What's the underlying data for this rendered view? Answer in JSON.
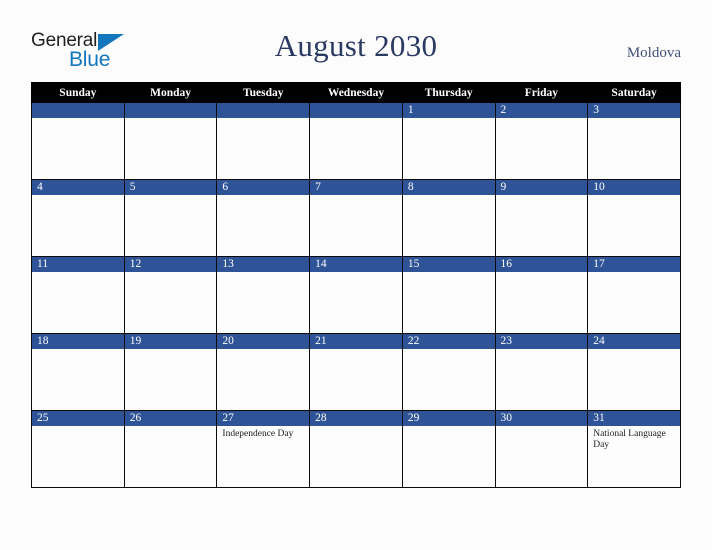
{
  "brand": {
    "name_part1": "General",
    "name_part2": "Blue",
    "triangle_color": "#1277bd",
    "text_color": "#231f20"
  },
  "header": {
    "title": "August 2030",
    "country": "Moldova",
    "title_color": "#2b3a63"
  },
  "calendar": {
    "weekday_headers": [
      "Sunday",
      "Monday",
      "Tuesday",
      "Wednesday",
      "Thursday",
      "Friday",
      "Saturday"
    ],
    "header_bg": "#000000",
    "daybar_bg": "#2e5396",
    "cell_bg": "#fdfdfd",
    "weeks": [
      [
        {
          "day": ""
        },
        {
          "day": ""
        },
        {
          "day": ""
        },
        {
          "day": ""
        },
        {
          "day": "1"
        },
        {
          "day": "2"
        },
        {
          "day": "3"
        }
      ],
      [
        {
          "day": "4"
        },
        {
          "day": "5"
        },
        {
          "day": "6"
        },
        {
          "day": "7"
        },
        {
          "day": "8"
        },
        {
          "day": "9"
        },
        {
          "day": "10"
        }
      ],
      [
        {
          "day": "11"
        },
        {
          "day": "12"
        },
        {
          "day": "13"
        },
        {
          "day": "14"
        },
        {
          "day": "15"
        },
        {
          "day": "16"
        },
        {
          "day": "17"
        }
      ],
      [
        {
          "day": "18"
        },
        {
          "day": "19"
        },
        {
          "day": "20"
        },
        {
          "day": "21"
        },
        {
          "day": "22"
        },
        {
          "day": "23"
        },
        {
          "day": "24"
        }
      ],
      [
        {
          "day": "25"
        },
        {
          "day": "26"
        },
        {
          "day": "27",
          "event": "Independence Day"
        },
        {
          "day": "28"
        },
        {
          "day": "29"
        },
        {
          "day": "30"
        },
        {
          "day": "31",
          "event": "National Language Day"
        }
      ]
    ]
  }
}
